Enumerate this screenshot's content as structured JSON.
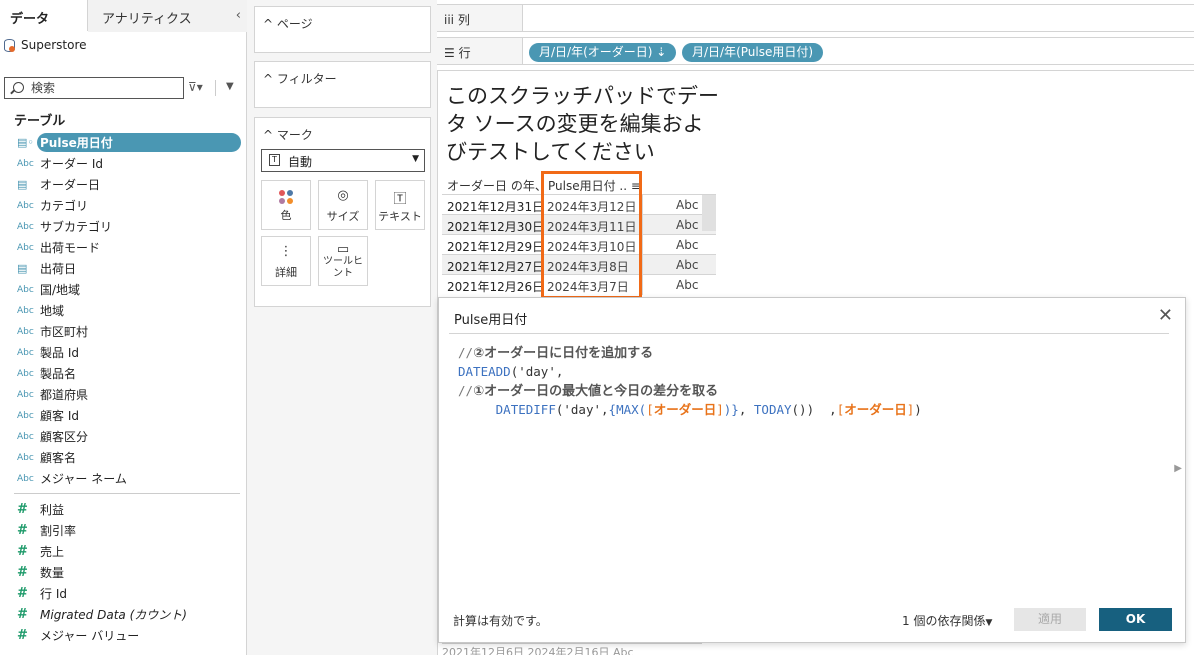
{
  "left_pane": {
    "tab_data": "データ",
    "tab_analytics": "アナリティクス",
    "collapse": "‹",
    "datasource": "Superstore",
    "search_placeholder": "検索",
    "section_tables": "テーブル",
    "fields": [
      {
        "icon": "calc-date",
        "label": "Pulse用日付",
        "selected": true
      },
      {
        "icon": "Abc",
        "label": "オーダー Id"
      },
      {
        "icon": "date",
        "label": "オーダー日"
      },
      {
        "icon": "Abc",
        "label": "カテゴリ"
      },
      {
        "icon": "Abc",
        "label": "サブカテゴリ"
      },
      {
        "icon": "Abc",
        "label": "出荷モード"
      },
      {
        "icon": "date",
        "label": "出荷日"
      },
      {
        "icon": "Abc",
        "label": "国/地域"
      },
      {
        "icon": "Abc",
        "label": "地域"
      },
      {
        "icon": "Abc",
        "label": "市区町村"
      },
      {
        "icon": "Abc",
        "label": "製品 Id"
      },
      {
        "icon": "Abc",
        "label": "製品名"
      },
      {
        "icon": "Abc",
        "label": "都道府県"
      },
      {
        "icon": "Abc",
        "label": "顧客 Id"
      },
      {
        "icon": "Abc",
        "label": "顧客区分"
      },
      {
        "icon": "Abc",
        "label": "顧客名"
      },
      {
        "icon": "Abc",
        "label": "メジャー ネーム"
      }
    ],
    "measures": [
      {
        "icon": "#",
        "label": "利益"
      },
      {
        "icon": "#",
        "label": "割引率"
      },
      {
        "icon": "#",
        "label": "売上"
      },
      {
        "icon": "#",
        "label": "数量"
      },
      {
        "icon": "#",
        "label": "行 Id"
      },
      {
        "icon": "#",
        "label": "Migrated Data (カウント)"
      },
      {
        "icon": "#",
        "label": "メジャー バリュー"
      }
    ]
  },
  "shelves": {
    "pages": "ページ",
    "filters": "フィルター",
    "marks": "マーク",
    "mark_type": "自動",
    "mark_buttons": [
      "色",
      "サイズ",
      "テキスト",
      "詳細",
      "ツールヒ\nント"
    ],
    "columns_label": "列",
    "rows_label": "行",
    "row_pills": [
      "月/日/年(オーダー日)",
      "月/日/年(Pulse用日付)"
    ]
  },
  "canvas": {
    "headline": "このスクラッチパッドでデータ ソースの変更を編集およびテストしてください",
    "col_headers": [
      "オーダー日 の年、",
      "Pulse用日付 .."
    ],
    "rows": [
      [
        "2021年12月31日",
        "2024年3月12日",
        "Abc"
      ],
      [
        "2021年12月30日",
        "2024年3月11日",
        "Abc"
      ],
      [
        "2021年12月29日",
        "2024年3月10日",
        "Abc"
      ],
      [
        "2021年12月27日",
        "2024年3月8日",
        "Abc"
      ],
      [
        "2021年12月26日",
        "2024年3月7日",
        "Abc"
      ]
    ],
    "bottom_row_peek": "2021年12月6日  2024年2月16日  Abc"
  },
  "dialog": {
    "title": "Pulse用日付",
    "close": "✕",
    "code": {
      "comment1_prefix": "//",
      "comment1": "②オーダー日に日付を追加する",
      "line2_fn": "DATEADD",
      "line2_rest": "('day',",
      "comment2_prefix": "//",
      "comment2": "①オーダー日の最大値と今日の差分を取る",
      "line4_indent": "     ",
      "line4_fn1": "DATEDIFF",
      "line4_arg": "('day',",
      "line4_fn2": "{MAX(",
      "field1": "オーダー日",
      "line4_close1": ")}",
      "line4_comma": ", ",
      "line4_fn3": "TODAY",
      "line4_paren": "())  ,",
      "field2": "オーダー日",
      "line4_end": ")"
    },
    "status": "計算は有効です。",
    "dependencies": "1 個の依存関係",
    "apply": "適用",
    "ok": "OK"
  },
  "colors": {
    "accent_pill": "#4a97b3",
    "highlight_box": "#f16a17",
    "ok_button": "#17607f",
    "field_orange": "#e8731a",
    "function_blue": "#3d72c0"
  }
}
